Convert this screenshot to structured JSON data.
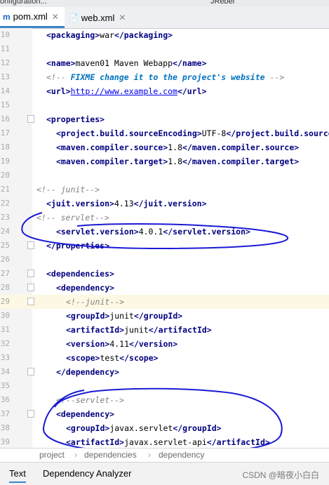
{
  "window": {
    "config_label": "onfiguration...",
    "plugin_label": "JRebel"
  },
  "tabs": [
    {
      "icon": "m",
      "label": "pom.xml"
    },
    {
      "icon": "📄",
      "label": "web.xml"
    }
  ],
  "editor": {
    "highlight_line": 29,
    "lines": [
      {
        "n": "10",
        "fold": false,
        "indent": 66,
        "parts": [
          [
            "t",
            "<packaging>"
          ],
          [
            "",
            "war"
          ],
          [
            "t",
            "</packaging>"
          ]
        ]
      },
      {
        "n": "11",
        "fold": false,
        "indent": 66,
        "parts": []
      },
      {
        "n": "12",
        "fold": false,
        "indent": 66,
        "parts": [
          [
            "t",
            "<name>"
          ],
          [
            "",
            "maven01 Maven Webapp"
          ],
          [
            "t",
            "</name>"
          ]
        ]
      },
      {
        "n": "13",
        "fold": false,
        "indent": 66,
        "parts": [
          [
            "c",
            "<!-- "
          ],
          [
            "todo",
            "FIXME change it to the project's website"
          ],
          [
            "c",
            " -->"
          ]
        ]
      },
      {
        "n": "14",
        "fold": false,
        "indent": 66,
        "parts": [
          [
            "t",
            "<url>"
          ],
          [
            "u",
            "http://www.example.com"
          ],
          [
            "t",
            "</url>"
          ]
        ]
      },
      {
        "n": "15",
        "fold": false,
        "indent": 66,
        "parts": []
      },
      {
        "n": "16",
        "fold": true,
        "indent": 66,
        "parts": [
          [
            "t",
            "<properties>"
          ]
        ]
      },
      {
        "n": "17",
        "fold": false,
        "indent": 80,
        "parts": [
          [
            "t",
            "<project.build.sourceEncoding>"
          ],
          [
            "",
            "UTF-8"
          ],
          [
            "t",
            "</project.build.source"
          ]
        ]
      },
      {
        "n": "18",
        "fold": false,
        "indent": 80,
        "parts": [
          [
            "t",
            "<maven.compiler.source>"
          ],
          [
            "",
            "1.8"
          ],
          [
            "t",
            "</maven.compiler.source>"
          ]
        ]
      },
      {
        "n": "19",
        "fold": false,
        "indent": 80,
        "parts": [
          [
            "t",
            "<maven.compiler.target>"
          ],
          [
            "",
            "1.8"
          ],
          [
            "t",
            "</maven.compiler.target>"
          ]
        ]
      },
      {
        "n": "20",
        "fold": false,
        "indent": 66,
        "parts": []
      },
      {
        "n": "21",
        "fold": false,
        "indent": 52,
        "parts": [
          [
            "c",
            "<!-- junit-->"
          ]
        ]
      },
      {
        "n": "22",
        "fold": false,
        "indent": 66,
        "parts": [
          [
            "t",
            "<juit.version>"
          ],
          [
            "",
            "4.13"
          ],
          [
            "t",
            "</juit.version>"
          ]
        ]
      },
      {
        "n": "23",
        "fold": false,
        "indent": 52,
        "parts": [
          [
            "c",
            "<!-- servlet-->"
          ]
        ]
      },
      {
        "n": "24",
        "fold": false,
        "indent": 80,
        "parts": [
          [
            "t",
            "<servlet.version>"
          ],
          [
            "",
            "4.0.1"
          ],
          [
            "t",
            "</servlet.version>"
          ]
        ]
      },
      {
        "n": "25",
        "fold": true,
        "indent": 66,
        "parts": [
          [
            "t",
            "</properties>"
          ]
        ]
      },
      {
        "n": "26",
        "fold": false,
        "indent": 66,
        "parts": []
      },
      {
        "n": "27",
        "fold": true,
        "indent": 66,
        "parts": [
          [
            "t",
            "<dependencies>"
          ]
        ]
      },
      {
        "n": "28",
        "fold": true,
        "indent": 80,
        "parts": [
          [
            "t",
            "<dependency>"
          ]
        ]
      },
      {
        "n": "29",
        "fold": true,
        "indent": 94,
        "parts": [
          [
            "c",
            "<!--junit-->"
          ]
        ]
      },
      {
        "n": "30",
        "fold": false,
        "indent": 94,
        "parts": [
          [
            "t",
            "<groupId>"
          ],
          [
            "",
            "junit"
          ],
          [
            "t",
            "</groupId>"
          ]
        ]
      },
      {
        "n": "31",
        "fold": false,
        "indent": 94,
        "parts": [
          [
            "t",
            "<artifactId>"
          ],
          [
            "",
            "junit"
          ],
          [
            "t",
            "</artifactId>"
          ]
        ]
      },
      {
        "n": "32",
        "fold": false,
        "indent": 94,
        "parts": [
          [
            "t",
            "<version>"
          ],
          [
            "",
            "4.11"
          ],
          [
            "t",
            "</version>"
          ]
        ]
      },
      {
        "n": "33",
        "fold": false,
        "indent": 94,
        "parts": [
          [
            "t",
            "<scope>"
          ],
          [
            "",
            "test"
          ],
          [
            "t",
            "</scope>"
          ]
        ]
      },
      {
        "n": "34",
        "fold": true,
        "indent": 80,
        "parts": [
          [
            "t",
            "</dependency>"
          ]
        ]
      },
      {
        "n": "35",
        "fold": false,
        "indent": 66,
        "parts": []
      },
      {
        "n": "36",
        "fold": false,
        "indent": 80,
        "parts": [
          [
            "c",
            "<!--servlet-->"
          ]
        ]
      },
      {
        "n": "37",
        "fold": true,
        "indent": 80,
        "parts": [
          [
            "t",
            "<dependency>"
          ]
        ]
      },
      {
        "n": "38",
        "fold": false,
        "indent": 94,
        "parts": [
          [
            "t",
            "<groupId>"
          ],
          [
            "",
            "javax.servlet"
          ],
          [
            "t",
            "</groupId>"
          ]
        ]
      },
      {
        "n": "39",
        "fold": false,
        "indent": 94,
        "parts": [
          [
            "t",
            "<artifactId>"
          ],
          [
            "",
            "javax.servlet-api"
          ],
          [
            "t",
            "</artifactId>"
          ]
        ]
      }
    ]
  },
  "breadcrumb": [
    "project",
    "dependencies",
    "dependency"
  ],
  "bottom_tabs": [
    "Text",
    "Dependency Analyzer"
  ],
  "watermark": "CSDN @暗夜小白白",
  "colors": {
    "tag": "#000080",
    "comment": "#808080",
    "todo": "#0073bf",
    "link": "#0000ee",
    "ink": "#1a1ad6",
    "highlight": "#fcf8e3"
  }
}
